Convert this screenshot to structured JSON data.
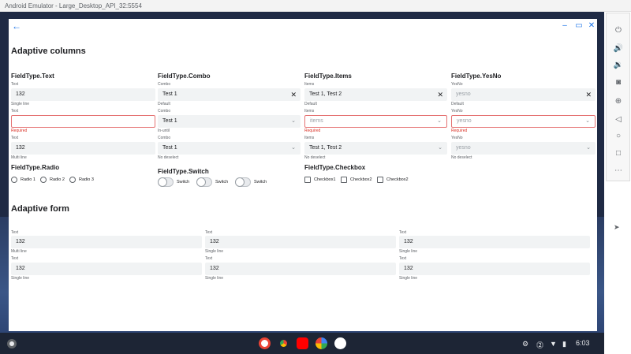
{
  "emulator": {
    "title": "Android Emulator - Large_Desktop_API_32:5554"
  },
  "window": {
    "back_icon": "arrow-left-icon",
    "minimize_icon": "minimize-icon",
    "maximize_icon": "maximize-icon",
    "close_icon": "close-icon"
  },
  "columns": {
    "title": "Adaptive columns",
    "text": {
      "heading": "FieldType.Text",
      "f1": {
        "label": "Text",
        "value": "132",
        "hint": "Single line"
      },
      "f2": {
        "label": "Text",
        "value": "",
        "hint": "Required"
      },
      "f3": {
        "label": "Text",
        "value": "132",
        "hint": "Multi line"
      }
    },
    "combo": {
      "heading": "FieldType.Combo",
      "f1": {
        "label": "Combo",
        "value": "Test 1",
        "hint": "Default"
      },
      "f2": {
        "label": "Combo",
        "value": "Test 1",
        "hint": "In-until"
      },
      "f3": {
        "label": "Combo",
        "value": "Test 1",
        "hint": "No deselect"
      }
    },
    "items": {
      "heading": "FieldType.Items",
      "f1": {
        "label": "Items",
        "value": "Test 1, Test 2",
        "hint": "Default"
      },
      "f2": {
        "label": "Items",
        "placeholder": "items",
        "hint": "Required"
      },
      "f3": {
        "label": "Items",
        "value": "Test 1, Test 2",
        "hint": "No deselect"
      }
    },
    "yesno": {
      "heading": "FieldType.YesNo",
      "f1": {
        "label": "YesNo",
        "placeholder": "yesno",
        "hint": "Default"
      },
      "f2": {
        "label": "YesNo",
        "placeholder": "yesno",
        "hint": "Required"
      },
      "f3": {
        "label": "YesNo",
        "placeholder": "yesno",
        "hint": "No deselect"
      }
    },
    "radio": {
      "heading": "FieldType.Radio",
      "options": [
        "Radio 1",
        "Radio 2",
        "Radio 3"
      ]
    },
    "switch": {
      "heading": "FieldType.Switch",
      "options": [
        "Switch",
        "Switch",
        "Switch"
      ]
    },
    "checkbox": {
      "heading": "FieldType.Checkbox",
      "options": [
        "Checkbox1",
        "Checkbox2",
        "Checkbox2"
      ]
    }
  },
  "form": {
    "title": "Adaptive form",
    "row1": [
      {
        "label": "Text",
        "value": "132",
        "hint": "Multi line"
      },
      {
        "label": "Text",
        "value": "132",
        "hint": "Single line"
      },
      {
        "label": "Text",
        "value": "132",
        "hint": "Single line"
      }
    ],
    "row2": [
      {
        "label": "Text",
        "value": "132",
        "hint": "Single line"
      },
      {
        "label": "Text",
        "value": "132",
        "hint": "Single line"
      },
      {
        "label": "Text",
        "value": "132",
        "hint": "Single line"
      }
    ]
  },
  "side_panel": [
    "power-icon",
    "volume-up-icon",
    "volume-down-icon",
    "camera-icon",
    "zoom-icon",
    "back-triangle-icon",
    "home-circle-icon",
    "overview-square-icon",
    "more-icon"
  ],
  "shelf": {
    "apps": [
      "gmail-icon",
      "chrome-icon",
      "youtube-icon",
      "photos-icon",
      "app-icon"
    ],
    "clock": "6:03"
  }
}
